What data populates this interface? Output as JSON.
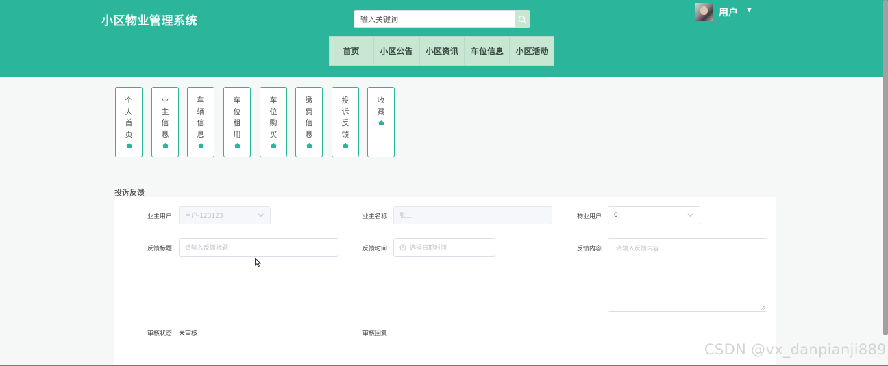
{
  "header": {
    "title": "小区物业管理系统",
    "search_placeholder": "输入关键词",
    "user_label": "用户"
  },
  "nav": [
    "首页",
    "小区公告",
    "小区资讯",
    "车位信息",
    "小区活动"
  ],
  "sidebar": [
    "个人首页",
    "业主信息",
    "车辆信息",
    "车位租用",
    "车位购买",
    "缴费信息",
    "投诉反馈",
    "收藏"
  ],
  "page_title": "投诉反馈",
  "form": {
    "owner_user_label": "业主用户",
    "owner_user_value": "用户-123123",
    "owner_name_label": "业主名称",
    "owner_name_value": "张三",
    "property_user_label": "物业用户",
    "property_user_value": "0",
    "feedback_title_label": "反馈标题",
    "feedback_title_placeholder": "请输入反馈标题",
    "feedback_time_label": "反馈时间",
    "feedback_time_placeholder": "选择日期时间",
    "feedback_content_label": "反馈内容",
    "feedback_content_placeholder": "请输入反馈内容",
    "review_status_label": "审核状态",
    "review_status_value": "未审核",
    "review_reply_label": "审核回复"
  },
  "watermark": "CSDN @vx_danpianji889",
  "colors": {
    "header": "#2bb59a",
    "nav_button": "#c8e7d3",
    "card_border": "#2bb59a"
  },
  "icons": [
    "search-icon",
    "caret-down-icon",
    "home-icon",
    "chevron-down-icon",
    "clock-icon",
    "resize-handle-icon",
    "cursor-icon"
  ]
}
